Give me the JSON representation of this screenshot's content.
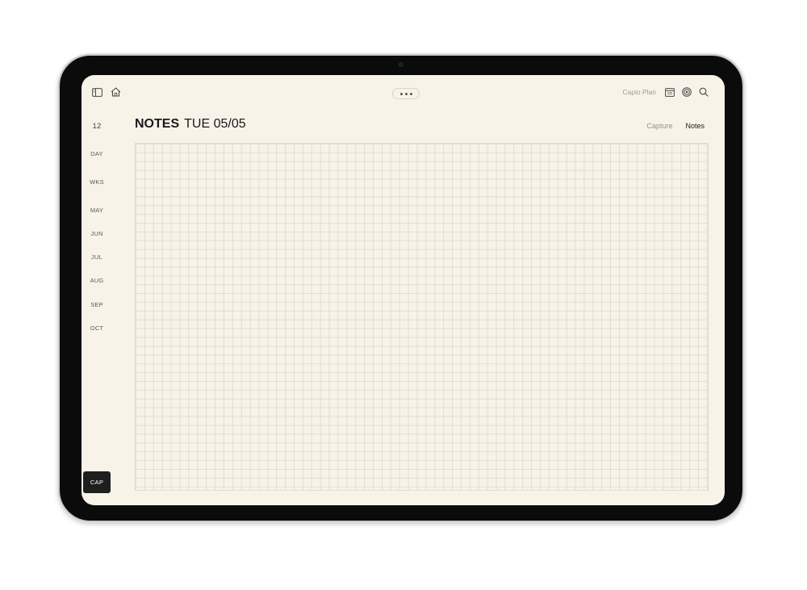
{
  "topbar": {
    "sidebar_toggle_icon": "sidebar-icon",
    "home_icon": "home-icon",
    "more_icon": "more-icon",
    "plan_label": "Capio Plan",
    "calendar_icon": "calendar-icon",
    "target_icon": "target-icon",
    "search_icon": "search-icon"
  },
  "sidebar": {
    "day_number": "12",
    "items": [
      "DAY",
      "WKS",
      "MAY",
      "JUN",
      "JUL",
      "AUG",
      "SEP",
      "OCT"
    ],
    "cap_label": "CAP"
  },
  "header": {
    "title": "NOTES",
    "date": "TUE 05/05"
  },
  "tabs": [
    {
      "label": "Capture",
      "active": false
    },
    {
      "label": "Notes",
      "active": true
    }
  ],
  "colors": {
    "paper": "#f7f3e8",
    "grid_line": "#e2ddcf",
    "bezel": "#0b0b0b",
    "cap_button": "#1e1e1e"
  }
}
